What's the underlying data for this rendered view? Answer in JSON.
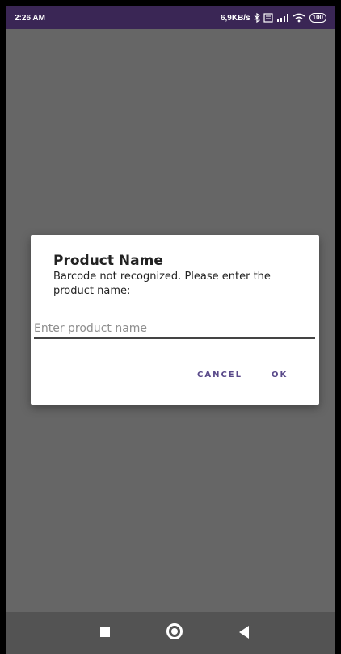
{
  "status_bar": {
    "time": "2:26 AM",
    "network_speed": "6,9KB/s",
    "battery": "100",
    "icons": [
      "bluetooth-icon",
      "data-icon",
      "signal-icon",
      "wifi-icon"
    ]
  },
  "dialog": {
    "title": "Product Name",
    "message": "Barcode not recognized. Please enter the product name:",
    "input": {
      "value": "",
      "placeholder": "Enter product name"
    },
    "buttons": {
      "cancel": "CANCEL",
      "ok": "OK"
    }
  },
  "colors": {
    "status_bar": "#3a2655",
    "app_background": "#666666",
    "dialog_background": "#ffffff",
    "button_text": "#5a4a8a",
    "navigation_bar": "#535353"
  },
  "navigation": {
    "icons": [
      "recent-apps-icon",
      "home-icon",
      "back-icon"
    ]
  }
}
